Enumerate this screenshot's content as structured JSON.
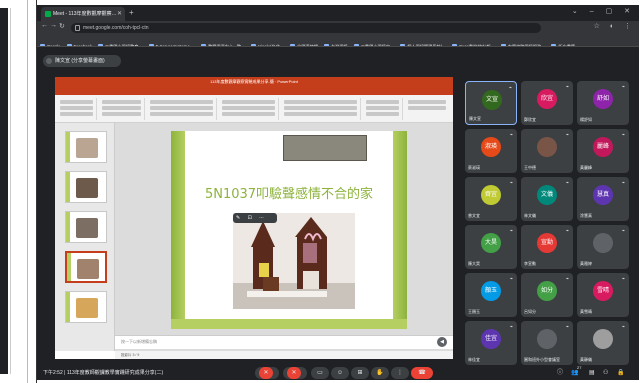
{
  "browser": {
    "tab_title": "Meet - 113年度數觀摩觀察…",
    "url": "meet.google.com/coh-tpcl-ctn",
    "bookmarks": [
      "Google",
      "Facebook",
      "三重國小資訊教育…",
      "E-Server System L…",
      "教學資源中心 - 教…",
      "Isinclu(台北…",
      "全國連絡網",
      "台灣資訊",
      "三重國小資訊中…",
      "個人資訊管理系統(…",
      "Excel製作統計報…",
      "大學校院資訊服務…",
      "所有書籤"
    ]
  },
  "meet": {
    "presenter_label": "陳文宣 (分享螢幕畫面)",
    "meeting_time": "下午2:52",
    "meeting_title": "113年度教師觀課教學實踐研究成果分享(二)",
    "participant_count": "27"
  },
  "powerpoint": {
    "window_title": "113年度數觀摩觀察實驗成果分享-簡 · PowerPoint",
    "menu": [
      "檔案",
      "常用",
      "插入",
      "設計",
      "轉場",
      "動畫",
      "投影片放映",
      "校閱",
      "檢視",
      "說明"
    ],
    "slide_title": "5N1037叩驗聲感情不合的家",
    "notes_placeholder": "按一下以新增備忘稿",
    "status": "投影片 3 / 9"
  },
  "participants": [
    {
      "initials": "文宣",
      "name": "陳文宣",
      "color": "#33691e",
      "active": true
    },
    {
      "initials": "欣宜",
      "name": "鄭欣宜",
      "color": "#d81b60"
    },
    {
      "initials": "舒如",
      "name": "楊舒如",
      "color": "#8e24aa"
    },
    {
      "initials": "淑瑛",
      "name": "蔡淑瑛",
      "color": "#e64a19"
    },
    {
      "initials": "",
      "name": "王中德",
      "color": "#795548"
    },
    {
      "initials": "麗峰",
      "name": "黃麗峰",
      "color": "#c2185b"
    },
    {
      "initials": "齊宜",
      "name": "曾文宜",
      "color": "#c0ca33"
    },
    {
      "initials": "文儀",
      "name": "林文儀",
      "color": "#00897b"
    },
    {
      "initials": "慧真",
      "name": "涂慧真",
      "color": "#5e35b1"
    },
    {
      "initials": "大昊",
      "name": "陳大昊",
      "color": "#43a047"
    },
    {
      "initials": "宣勳",
      "name": "李宣勳",
      "color": "#e53935"
    },
    {
      "initials": "",
      "name": "黃雅婷",
      "color": "#5f6368"
    },
    {
      "initials": "顏玉",
      "name": "王顏玉",
      "color": "#039be5"
    },
    {
      "initials": "如分",
      "name": "呂如分",
      "color": "#43a047"
    },
    {
      "initials": "雪晴",
      "name": "黃雪晴",
      "color": "#d81b60"
    },
    {
      "initials": "佳宜",
      "name": "林佳宜",
      "color": "#5e35b1"
    },
    {
      "initials": "",
      "name": "圓和班外小型會議室",
      "color": "#5f6368"
    },
    {
      "initials": "",
      "name": "黃靜儀",
      "color": "#9e9e9e"
    }
  ]
}
